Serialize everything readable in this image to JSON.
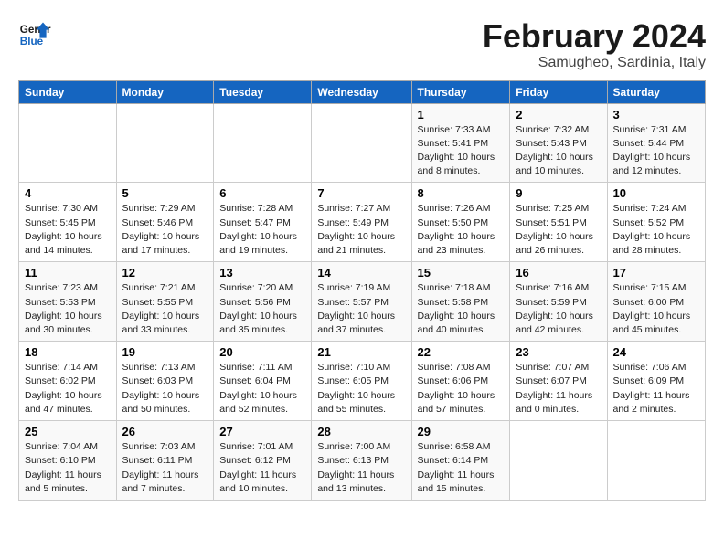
{
  "logo": {
    "line1": "General",
    "line2": "Blue"
  },
  "title": "February 2024",
  "subtitle": "Samugheo, Sardinia, Italy",
  "weekdays": [
    "Sunday",
    "Monday",
    "Tuesday",
    "Wednesday",
    "Thursday",
    "Friday",
    "Saturday"
  ],
  "weeks": [
    [
      {
        "day": "",
        "detail": ""
      },
      {
        "day": "",
        "detail": ""
      },
      {
        "day": "",
        "detail": ""
      },
      {
        "day": "",
        "detail": ""
      },
      {
        "day": "1",
        "detail": "Sunrise: 7:33 AM\nSunset: 5:41 PM\nDaylight: 10 hours\nand 8 minutes."
      },
      {
        "day": "2",
        "detail": "Sunrise: 7:32 AM\nSunset: 5:43 PM\nDaylight: 10 hours\nand 10 minutes."
      },
      {
        "day": "3",
        "detail": "Sunrise: 7:31 AM\nSunset: 5:44 PM\nDaylight: 10 hours\nand 12 minutes."
      }
    ],
    [
      {
        "day": "4",
        "detail": "Sunrise: 7:30 AM\nSunset: 5:45 PM\nDaylight: 10 hours\nand 14 minutes."
      },
      {
        "day": "5",
        "detail": "Sunrise: 7:29 AM\nSunset: 5:46 PM\nDaylight: 10 hours\nand 17 minutes."
      },
      {
        "day": "6",
        "detail": "Sunrise: 7:28 AM\nSunset: 5:47 PM\nDaylight: 10 hours\nand 19 minutes."
      },
      {
        "day": "7",
        "detail": "Sunrise: 7:27 AM\nSunset: 5:49 PM\nDaylight: 10 hours\nand 21 minutes."
      },
      {
        "day": "8",
        "detail": "Sunrise: 7:26 AM\nSunset: 5:50 PM\nDaylight: 10 hours\nand 23 minutes."
      },
      {
        "day": "9",
        "detail": "Sunrise: 7:25 AM\nSunset: 5:51 PM\nDaylight: 10 hours\nand 26 minutes."
      },
      {
        "day": "10",
        "detail": "Sunrise: 7:24 AM\nSunset: 5:52 PM\nDaylight: 10 hours\nand 28 minutes."
      }
    ],
    [
      {
        "day": "11",
        "detail": "Sunrise: 7:23 AM\nSunset: 5:53 PM\nDaylight: 10 hours\nand 30 minutes."
      },
      {
        "day": "12",
        "detail": "Sunrise: 7:21 AM\nSunset: 5:55 PM\nDaylight: 10 hours\nand 33 minutes."
      },
      {
        "day": "13",
        "detail": "Sunrise: 7:20 AM\nSunset: 5:56 PM\nDaylight: 10 hours\nand 35 minutes."
      },
      {
        "day": "14",
        "detail": "Sunrise: 7:19 AM\nSunset: 5:57 PM\nDaylight: 10 hours\nand 37 minutes."
      },
      {
        "day": "15",
        "detail": "Sunrise: 7:18 AM\nSunset: 5:58 PM\nDaylight: 10 hours\nand 40 minutes."
      },
      {
        "day": "16",
        "detail": "Sunrise: 7:16 AM\nSunset: 5:59 PM\nDaylight: 10 hours\nand 42 minutes."
      },
      {
        "day": "17",
        "detail": "Sunrise: 7:15 AM\nSunset: 6:00 PM\nDaylight: 10 hours\nand 45 minutes."
      }
    ],
    [
      {
        "day": "18",
        "detail": "Sunrise: 7:14 AM\nSunset: 6:02 PM\nDaylight: 10 hours\nand 47 minutes."
      },
      {
        "day": "19",
        "detail": "Sunrise: 7:13 AM\nSunset: 6:03 PM\nDaylight: 10 hours\nand 50 minutes."
      },
      {
        "day": "20",
        "detail": "Sunrise: 7:11 AM\nSunset: 6:04 PM\nDaylight: 10 hours\nand 52 minutes."
      },
      {
        "day": "21",
        "detail": "Sunrise: 7:10 AM\nSunset: 6:05 PM\nDaylight: 10 hours\nand 55 minutes."
      },
      {
        "day": "22",
        "detail": "Sunrise: 7:08 AM\nSunset: 6:06 PM\nDaylight: 10 hours\nand 57 minutes."
      },
      {
        "day": "23",
        "detail": "Sunrise: 7:07 AM\nSunset: 6:07 PM\nDaylight: 11 hours\nand 0 minutes."
      },
      {
        "day": "24",
        "detail": "Sunrise: 7:06 AM\nSunset: 6:09 PM\nDaylight: 11 hours\nand 2 minutes."
      }
    ],
    [
      {
        "day": "25",
        "detail": "Sunrise: 7:04 AM\nSunset: 6:10 PM\nDaylight: 11 hours\nand 5 minutes."
      },
      {
        "day": "26",
        "detail": "Sunrise: 7:03 AM\nSunset: 6:11 PM\nDaylight: 11 hours\nand 7 minutes."
      },
      {
        "day": "27",
        "detail": "Sunrise: 7:01 AM\nSunset: 6:12 PM\nDaylight: 11 hours\nand 10 minutes."
      },
      {
        "day": "28",
        "detail": "Sunrise: 7:00 AM\nSunset: 6:13 PM\nDaylight: 11 hours\nand 13 minutes."
      },
      {
        "day": "29",
        "detail": "Sunrise: 6:58 AM\nSunset: 6:14 PM\nDaylight: 11 hours\nand 15 minutes."
      },
      {
        "day": "",
        "detail": ""
      },
      {
        "day": "",
        "detail": ""
      }
    ]
  ]
}
